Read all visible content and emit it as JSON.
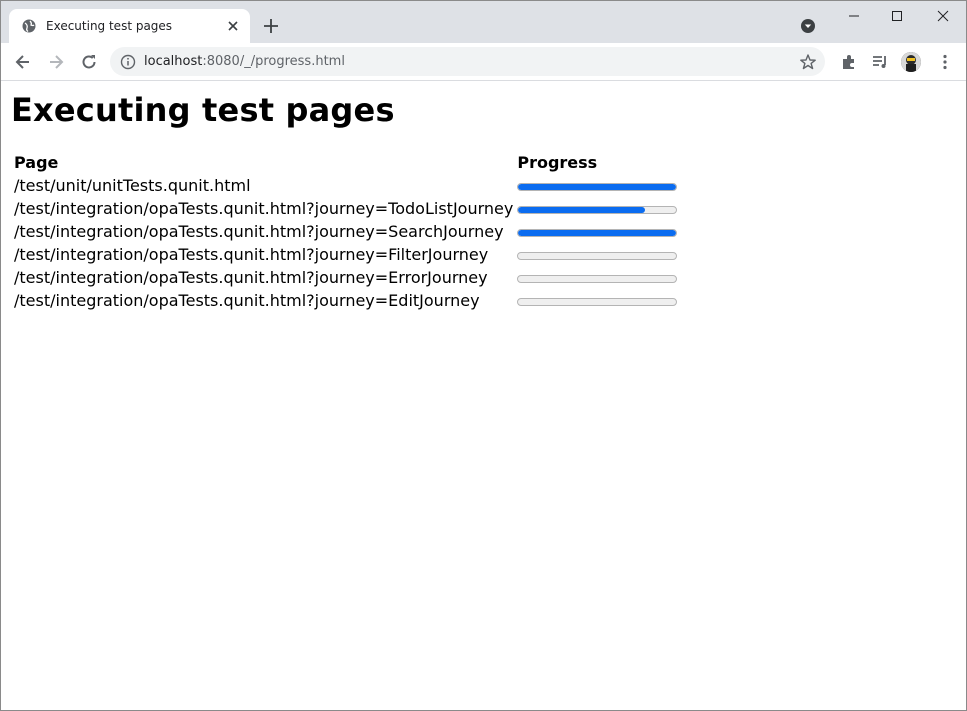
{
  "browser": {
    "tab_title": "Executing test pages",
    "url_host": "localhost",
    "url_rest": ":8080/_/progress.html",
    "accent_color": "#0b6cf0"
  },
  "page": {
    "heading": "Executing test pages",
    "columns": {
      "page": "Page",
      "progress": "Progress"
    },
    "rows": [
      {
        "page": "/test/unit/unitTests.qunit.html",
        "progress": 1.0
      },
      {
        "page": "/test/integration/opaTests.qunit.html?journey=TodoListJourney",
        "progress": 0.8
      },
      {
        "page": "/test/integration/opaTests.qunit.html?journey=SearchJourney",
        "progress": 1.0
      },
      {
        "page": "/test/integration/opaTests.qunit.html?journey=FilterJourney",
        "progress": 0.0
      },
      {
        "page": "/test/integration/opaTests.qunit.html?journey=ErrorJourney",
        "progress": 0.0
      },
      {
        "page": "/test/integration/opaTests.qunit.html?journey=EditJourney",
        "progress": 0.0
      }
    ]
  }
}
